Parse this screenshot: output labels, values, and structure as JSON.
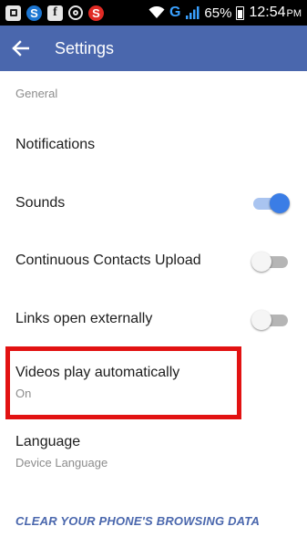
{
  "status_bar": {
    "battery_percent": "65%",
    "time": "12:54",
    "ampm": "PM",
    "network_type": "G"
  },
  "app_bar": {
    "title": "Settings",
    "back_icon": "arrow-back-icon"
  },
  "section": {
    "header": "General"
  },
  "settings": [
    {
      "title": "Notifications"
    },
    {
      "title": "Sounds",
      "toggle": "on"
    },
    {
      "title": "Continuous Contacts Upload",
      "toggle": "off"
    },
    {
      "title": "Links open externally",
      "toggle": "off"
    },
    {
      "title": "Videos play automatically",
      "subtitle": "On"
    },
    {
      "title": "Language",
      "subtitle": "Device Language"
    }
  ],
  "clear_data_label": "CLEAR YOUR PHONE'S BROWSING DATA",
  "colors": {
    "app_bar": "#4a67ad",
    "toggle_on": "#3a7de6",
    "highlight": "#e21212"
  }
}
